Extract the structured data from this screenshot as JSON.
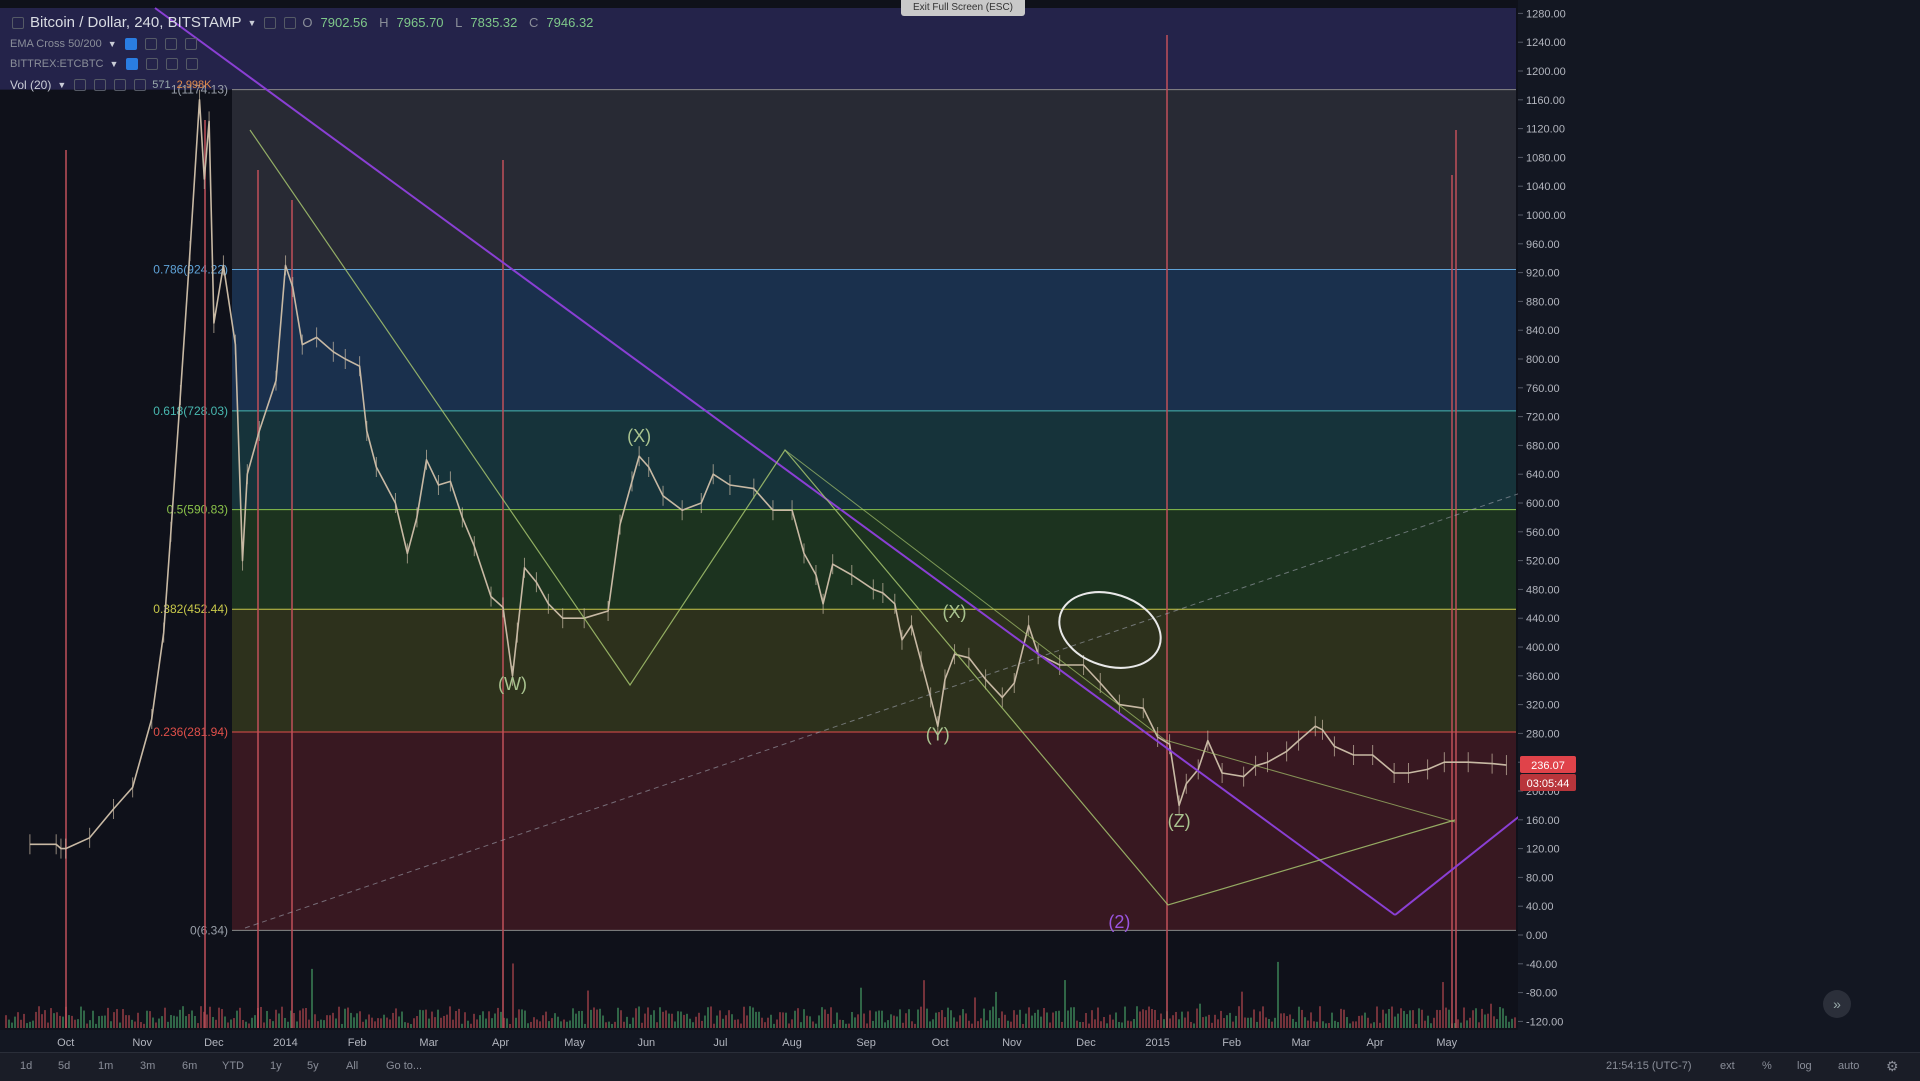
{
  "header": {
    "symbol": "Bitcoin / Dollar, 240, BITSTAMP",
    "open_label": "O",
    "open": "7902.56",
    "high_label": "H",
    "high": "7965.70",
    "low_label": "L",
    "low": "7835.32",
    "close_label": "C",
    "close": "7946.32",
    "indicator1": "EMA Cross 50/200",
    "indicator2": "BITTREX:ETCBTC",
    "volume_label": "Vol (20)",
    "volume_value1": "571",
    "volume_value2": "2.998K",
    "exit_fullscreen": "Exit Full Screen (ESC)"
  },
  "colors": {
    "background": "#0f111a",
    "candle": "#c8b9a4",
    "fib_top": "#24234a",
    "fib_786": "#2a2c36",
    "fib_618": "#1b3350",
    "fib_5": "#17363c",
    "fib_382": "#1d3620",
    "fib_236": "#2f341c",
    "fib_0": "#3b1922",
    "purple_line": "#8a3fd4",
    "green_line": "#a6c46e",
    "label_green": "#a9c38f",
    "label_purple": "#9b55e0",
    "price_badge": "#e0434a"
  },
  "chart_data": {
    "type": "line",
    "title": "Bitcoin / Dollar, 240, BITSTAMP",
    "x_ticks": [
      "Oct",
      "Nov",
      "Dec",
      "2014",
      "Feb",
      "Mar",
      "Apr",
      "May",
      "Jun",
      "Jul",
      "Aug",
      "Sep",
      "Oct",
      "Nov",
      "Dec",
      "2015",
      "Feb",
      "Mar",
      "Apr",
      "May"
    ],
    "y_ticks": [
      "1280.00",
      "1240.00",
      "1200.00",
      "1160.00",
      "1120.00",
      "1080.00",
      "1040.00",
      "1000.00",
      "960.00",
      "920.00",
      "880.00",
      "840.00",
      "800.00",
      "760.00",
      "720.00",
      "680.00",
      "640.00",
      "600.00",
      "560.00",
      "520.00",
      "480.00",
      "440.00",
      "400.00",
      "360.00",
      "320.00",
      "280.00",
      "240.00",
      "200.00",
      "160.00",
      "120.00",
      "80.00",
      "40.00",
      "0.00",
      "-40.00",
      "-80.00",
      "-120.00"
    ],
    "ylim": [
      -120,
      1280
    ],
    "series": [
      {
        "values": [
          {
            "x": "2013-09-20",
            "y": 126
          },
          {
            "x": "2013-10-01",
            "y": 126
          },
          {
            "x": "2013-10-03",
            "y": 120
          },
          {
            "x": "2013-10-05",
            "y": 120
          },
          {
            "x": "2013-10-15",
            "y": 135
          },
          {
            "x": "2013-10-25",
            "y": 175
          },
          {
            "x": "2013-11-02",
            "y": 205
          },
          {
            "x": "2013-11-10",
            "y": 300
          },
          {
            "x": "2013-11-15",
            "y": 420
          },
          {
            "x": "2013-11-18",
            "y": 560
          },
          {
            "x": "2013-11-22",
            "y": 750
          },
          {
            "x": "2013-11-26",
            "y": 950
          },
          {
            "x": "2013-11-30",
            "y": 1160
          },
          {
            "x": "2013-12-02",
            "y": 1050
          },
          {
            "x": "2013-12-04",
            "y": 1130
          },
          {
            "x": "2013-12-06",
            "y": 850
          },
          {
            "x": "2013-12-10",
            "y": 930
          },
          {
            "x": "2013-12-15",
            "y": 820
          },
          {
            "x": "2013-12-18",
            "y": 520
          },
          {
            "x": "2013-12-20",
            "y": 640
          },
          {
            "x": "2013-12-25",
            "y": 700
          },
          {
            "x": "2014-01-01",
            "y": 770
          },
          {
            "x": "2014-01-05",
            "y": 930
          },
          {
            "x": "2014-01-08",
            "y": 900
          },
          {
            "x": "2014-01-12",
            "y": 820
          },
          {
            "x": "2014-01-18",
            "y": 830
          },
          {
            "x": "2014-01-25",
            "y": 810
          },
          {
            "x": "2014-01-30",
            "y": 800
          },
          {
            "x": "2014-02-05",
            "y": 790
          },
          {
            "x": "2014-02-08",
            "y": 700
          },
          {
            "x": "2014-02-12",
            "y": 650
          },
          {
            "x": "2014-02-20",
            "y": 600
          },
          {
            "x": "2014-02-25",
            "y": 530
          },
          {
            "x": "2014-03-01",
            "y": 580
          },
          {
            "x": "2014-03-05",
            "y": 660
          },
          {
            "x": "2014-03-10",
            "y": 625
          },
          {
            "x": "2014-03-15",
            "y": 630
          },
          {
            "x": "2014-03-20",
            "y": 580
          },
          {
            "x": "2014-03-25",
            "y": 540
          },
          {
            "x": "2014-04-01",
            "y": 470
          },
          {
            "x": "2014-04-06",
            "y": 455
          },
          {
            "x": "2014-04-10",
            "y": 360
          },
          {
            "x": "2014-04-12",
            "y": 420
          },
          {
            "x": "2014-04-15",
            "y": 510
          },
          {
            "x": "2014-04-20",
            "y": 490
          },
          {
            "x": "2014-04-25",
            "y": 460
          },
          {
            "x": "2014-05-01",
            "y": 440
          },
          {
            "x": "2014-05-10",
            "y": 440
          },
          {
            "x": "2014-05-20",
            "y": 450
          },
          {
            "x": "2014-05-25",
            "y": 570
          },
          {
            "x": "2014-05-30",
            "y": 630
          },
          {
            "x": "2014-06-02",
            "y": 665
          },
          {
            "x": "2014-06-06",
            "y": 650
          },
          {
            "x": "2014-06-12",
            "y": 610
          },
          {
            "x": "2014-06-20",
            "y": 590
          },
          {
            "x": "2014-06-28",
            "y": 600
          },
          {
            "x": "2014-07-03",
            "y": 640
          },
          {
            "x": "2014-07-10",
            "y": 625
          },
          {
            "x": "2014-07-20",
            "y": 620
          },
          {
            "x": "2014-07-28",
            "y": 590
          },
          {
            "x": "2014-08-05",
            "y": 590
          },
          {
            "x": "2014-08-10",
            "y": 530
          },
          {
            "x": "2014-08-15",
            "y": 500
          },
          {
            "x": "2014-08-18",
            "y": 460
          },
          {
            "x": "2014-08-22",
            "y": 515
          },
          {
            "x": "2014-08-30",
            "y": 500
          },
          {
            "x": "2014-09-08",
            "y": 480
          },
          {
            "x": "2014-09-12",
            "y": 475
          },
          {
            "x": "2014-09-17",
            "y": 460
          },
          {
            "x": "2014-09-20",
            "y": 410
          },
          {
            "x": "2014-09-24",
            "y": 430
          },
          {
            "x": "2014-09-28",
            "y": 380
          },
          {
            "x": "2014-10-02",
            "y": 330
          },
          {
            "x": "2014-10-05",
            "y": 290
          },
          {
            "x": "2014-10-08",
            "y": 355
          },
          {
            "x": "2014-10-12",
            "y": 390
          },
          {
            "x": "2014-10-18",
            "y": 385
          },
          {
            "x": "2014-10-25",
            "y": 355
          },
          {
            "x": "2014-11-01",
            "y": 330
          },
          {
            "x": "2014-11-06",
            "y": 350
          },
          {
            "x": "2014-11-12",
            "y": 430
          },
          {
            "x": "2014-11-16",
            "y": 390
          },
          {
            "x": "2014-11-25",
            "y": 375
          },
          {
            "x": "2014-12-05",
            "y": 375
          },
          {
            "x": "2014-12-12",
            "y": 350
          },
          {
            "x": "2014-12-20",
            "y": 320
          },
          {
            "x": "2014-12-30",
            "y": 315
          },
          {
            "x": "2015-01-05",
            "y": 275
          },
          {
            "x": "2015-01-10",
            "y": 265
          },
          {
            "x": "2015-01-14",
            "y": 180
          },
          {
            "x": "2015-01-17",
            "y": 210
          },
          {
            "x": "2015-01-22",
            "y": 230
          },
          {
            "x": "2015-01-26",
            "y": 270
          },
          {
            "x": "2015-02-01",
            "y": 225
          },
          {
            "x": "2015-02-10",
            "y": 220
          },
          {
            "x": "2015-02-15",
            "y": 235
          },
          {
            "x": "2015-02-20",
            "y": 240
          },
          {
            "x": "2015-02-28",
            "y": 255
          },
          {
            "x": "2015-03-05",
            "y": 270
          },
          {
            "x": "2015-03-12",
            "y": 290
          },
          {
            "x": "2015-03-15",
            "y": 285
          },
          {
            "x": "2015-03-20",
            "y": 262
          },
          {
            "x": "2015-03-28",
            "y": 250
          },
          {
            "x": "2015-04-05",
            "y": 250
          },
          {
            "x": "2015-04-14",
            "y": 225
          },
          {
            "x": "2015-04-20",
            "y": 225
          },
          {
            "x": "2015-04-28",
            "y": 230
          },
          {
            "x": "2015-05-05",
            "y": 240
          },
          {
            "x": "2015-05-15",
            "y": 240
          },
          {
            "x": "2015-05-25",
            "y": 238
          },
          {
            "x": "2015-05-31",
            "y": 236
          }
        ]
      }
    ],
    "fib_levels": [
      {
        "label": "1(1174.13)",
        "value": 1174.13
      },
      {
        "label": "0.786(924.22)",
        "value": 924.22
      },
      {
        "label": "0.618(728.03)",
        "value": 728.03
      },
      {
        "label": "0.5(590.83)",
        "value": 590.83
      },
      {
        "label": "0.382(452.44)",
        "value": 452.44
      },
      {
        "label": "0.236(281.94)",
        "value": 281.94
      },
      {
        "label": "0(6.34)",
        "value": 6.34
      }
    ],
    "wave_labels": [
      {
        "text": "(X)",
        "x": "2014-06-02",
        "y": 685
      },
      {
        "text": "(W)",
        "x": "2014-04-10",
        "y": 340
      },
      {
        "text": "(X)",
        "x": "2014-10-12",
        "y": 440
      },
      {
        "text": "(Y)",
        "x": "2014-10-05",
        "y": 270
      },
      {
        "text": "(Z)",
        "x": "2015-01-14",
        "y": 150
      },
      {
        "text": "(2)",
        "x": "2014-12-20",
        "y": 10
      }
    ],
    "current_price": "236.07",
    "countdown": "03:05:44",
    "volume_axis_note": "volume histogram along bottom"
  },
  "bottom_bar": {
    "ranges": [
      "1d",
      "5d",
      "1m",
      "3m",
      "6m",
      "YTD",
      "1y",
      "5y",
      "All"
    ],
    "goto": "Go to...",
    "time": "21:54:15 (UTC-7)",
    "ext": "ext",
    "percent": "%",
    "log": "log",
    "auto": "auto"
  }
}
